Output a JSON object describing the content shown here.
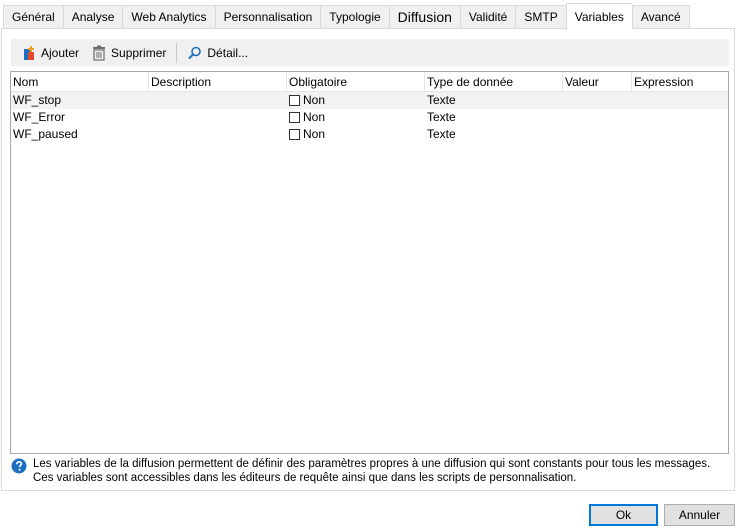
{
  "tabs": [
    {
      "label": "Général"
    },
    {
      "label": "Analyse"
    },
    {
      "label": "Web Analytics"
    },
    {
      "label": "Personnalisation"
    },
    {
      "label": "Typologie"
    },
    {
      "label": "Diffusion"
    },
    {
      "label": "Validité"
    },
    {
      "label": "SMTP"
    },
    {
      "label": "Variables"
    },
    {
      "label": "Avancé"
    }
  ],
  "active_tab": "Variables",
  "toolbar": {
    "add_label": "Ajouter",
    "delete_label": "Supprimer",
    "detail_label": "Détail..."
  },
  "grid": {
    "columns": [
      "Nom",
      "Description",
      "Obligatoire",
      "Type de donnée",
      "Valeur",
      "Expression"
    ],
    "rows": [
      {
        "name": "WF_stop",
        "description": "",
        "mandatory": "Non",
        "type": "Texte",
        "value": "",
        "expression": ""
      },
      {
        "name": "WF_Error",
        "description": "",
        "mandatory": "Non",
        "type": "Texte",
        "value": "",
        "expression": ""
      },
      {
        "name": "WF_paused",
        "description": "",
        "mandatory": "Non",
        "type": "Texte",
        "value": "",
        "expression": ""
      }
    ]
  },
  "help": {
    "line1": "Les variables de la diffusion permettent de définir des paramètres propres à une diffusion qui sont constants pour tous les messages.",
    "line2": "Ces variables sont accessibles dans les éditeurs de requête ainsi que dans les scripts de personnalisation."
  },
  "buttons": {
    "ok_label": "Ok",
    "cancel_label": "Annuler"
  },
  "colors": {
    "accent": "#0078d7",
    "help_icon": "#1e6fc1"
  }
}
